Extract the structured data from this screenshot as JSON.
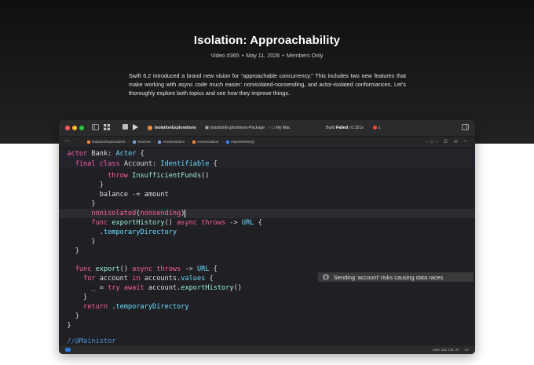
{
  "page": {
    "title": "Isolation: Approachability",
    "meta": {
      "video": "Video #365",
      "date": "May 11, 2026",
      "access": "Members Only"
    },
    "description": "Swift 6.2 introduced a brand new vision for “approachable concurrency.” This includes two new features that make working with async code much easier: nonisolated-nonsending, and actor-isolated conformances. Let’s thoroughly explore both topics and see how they improve things."
  },
  "xcode": {
    "toolbar": {
      "scheme": "IsolationExplorations",
      "destination": "IsolationExplorations-Package",
      "device": "My Mac",
      "build_prefix": "Build",
      "build_status": "Failed",
      "build_time": "| 0.321s",
      "error_count": "1"
    },
    "jumpbar": {
      "crumbs": [
        "IsolationExplorations",
        "Sources",
        "ActorIsolation",
        "ActorIsolation",
        "exportHistory()"
      ]
    },
    "code": {
      "sticky1": {
        "kw": "actor",
        "name": "Bank",
        "colon": ": ",
        "type": "Actor",
        "brace": " {"
      },
      "sticky2": {
        "kw": "final class",
        "name": "Account",
        "colon": ": ",
        "type": "Identifiable",
        "brace": " {"
      },
      "line_throw": {
        "kw": "throw",
        "type": "InsufficientFunds",
        "rest": "()"
      },
      "line_close1": "}",
      "line_balance": {
        "name": "balance",
        "rest": " -= amount"
      },
      "line_close2": "}",
      "line_nonisolated": {
        "kw": "nonisolated",
        "open": "(",
        "arg": "nonsending",
        "close": ")"
      },
      "line_export_history": {
        "kw": "func",
        "name": "exportHistory",
        "rest1": "() ",
        "kw2": "async throws",
        "arrow": " -> ",
        "type": "URL",
        "brace": " {"
      },
      "line_temp1": {
        "dot": ".",
        "name": "temporaryDirectory"
      },
      "line_close3": "}",
      "line_close4": "}",
      "line_export": {
        "kw": "func",
        "name": "export",
        "rest1": "() ",
        "kw2": "async throws",
        "arrow": " -> ",
        "type": "URL",
        "brace": " {"
      },
      "line_for": {
        "kw": "for",
        "var": " account ",
        "kw2": "in",
        "rest": " accounts.",
        "name": "values",
        "brace": " {"
      },
      "line_try": {
        "pre": "_ = ",
        "kw": "try await",
        "rest": " account.",
        "name": "exportHistory",
        "close": "()"
      },
      "line_close5": "}",
      "line_return": {
        "kw": "return",
        "dot": " .",
        "name": "temporaryDirectory"
      },
      "line_close6": "}",
      "line_close7": "}",
      "line_comment": "//@Mainistor"
    },
    "warning": "Sending 'account' risks causing data races",
    "status": {
      "position": "Line: 111  Col: 27"
    }
  }
}
